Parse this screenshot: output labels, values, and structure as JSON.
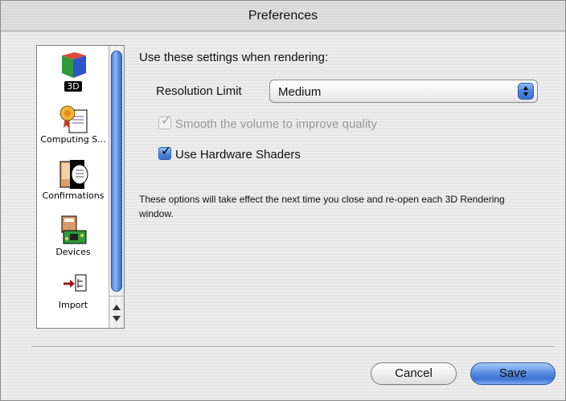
{
  "window": {
    "title": "Preferences"
  },
  "sidebar": {
    "items": [
      {
        "label": "3D",
        "icon": "3d-cube-icon",
        "selected": true
      },
      {
        "label": "Computing S...",
        "icon": "award-ribbon-icon",
        "selected": false
      },
      {
        "label": "Confirmations",
        "icon": "speech-balloon-icon",
        "selected": false
      },
      {
        "label": "Devices",
        "icon": "circuit-board-icon",
        "selected": false
      },
      {
        "label": "Import",
        "icon": "import-arrow-icon",
        "selected": false
      }
    ]
  },
  "main": {
    "heading": "Use these settings when rendering:",
    "resolution": {
      "label": "Resolution Limit",
      "value": "Medium"
    },
    "smooth_checkbox": {
      "label": "Smooth the volume to improve quality",
      "checked": true,
      "enabled": false
    },
    "shaders_checkbox": {
      "label": "Use Hardware Shaders",
      "checked": true,
      "enabled": true
    },
    "note": "These options will take effect the next time you close and re-open each 3D Rendering window."
  },
  "buttons": {
    "cancel": "Cancel",
    "save": "Save"
  },
  "colors": {
    "accent_blue": "#4d84dc",
    "window_bg": "#ececec"
  }
}
